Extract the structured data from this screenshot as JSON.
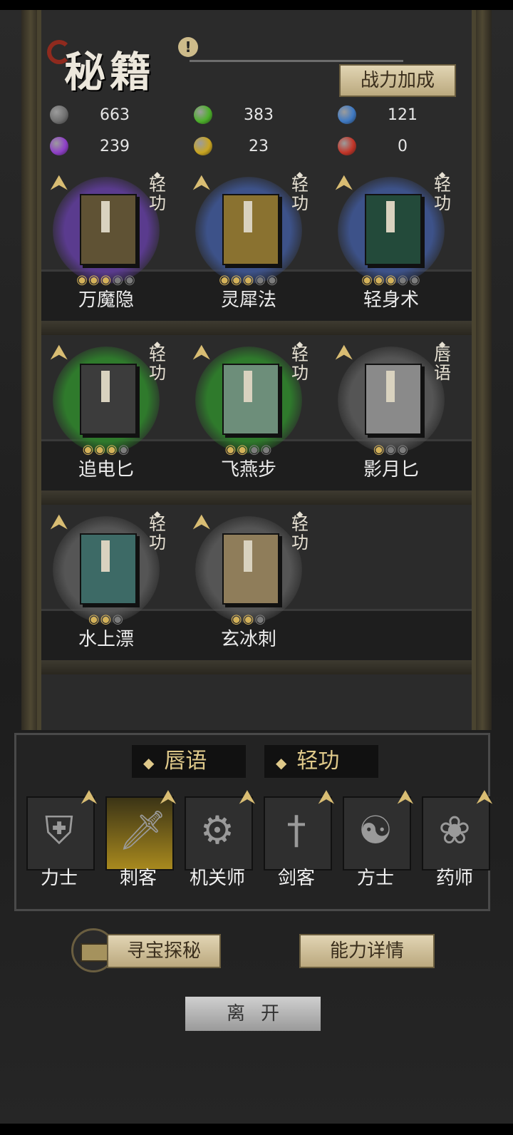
{
  "title": "秘籍",
  "bonus_button": "战力加成",
  "resources": [
    {
      "icon": "gray-gem-icon",
      "color": "#707070",
      "value": "663"
    },
    {
      "icon": "green-gem-icon",
      "color": "#4caf2a",
      "value": "383"
    },
    {
      "icon": "blue-gem-icon",
      "color": "#3f79c2",
      "value": "121"
    },
    {
      "icon": "purple-gem-icon",
      "color": "#8e3fc7",
      "value": "239"
    },
    {
      "icon": "gold-gem-icon",
      "color": "#c9a521",
      "value": "23"
    },
    {
      "icon": "red-gem-icon",
      "color": "#c23528",
      "value": "0"
    }
  ],
  "books": [
    {
      "name": "万魔隐",
      "type": "轻功",
      "aura": "#5a3b8e",
      "cover": "#5f5234",
      "stars_on": 3,
      "stars_total": 5
    },
    {
      "name": "灵犀法",
      "type": "轻功",
      "aura": "#3d5289",
      "cover": "#8a7230",
      "stars_on": 3,
      "stars_total": 5
    },
    {
      "name": "轻身术",
      "type": "轻功",
      "aura": "#3d5289",
      "cover": "#234a3a",
      "stars_on": 3,
      "stars_total": 5
    },
    {
      "name": "追电匕",
      "type": "轻功",
      "aura": "#2f7a2c",
      "cover": "#3c3c3c",
      "stars_on": 3,
      "stars_total": 4
    },
    {
      "name": "飞燕步",
      "type": "轻功",
      "aura": "#2f7a2c",
      "cover": "#6d8e7a",
      "stars_on": 2,
      "stars_total": 4
    },
    {
      "name": "影月匕",
      "type": "唇语",
      "aura": "#555555",
      "cover": "#8a8a8a",
      "stars_on": 1,
      "stars_total": 3
    },
    {
      "name": "水上漂",
      "type": "轻功",
      "aura": "#555555",
      "cover": "#3d6a66",
      "stars_on": 2,
      "stars_total": 3
    },
    {
      "name": "玄冰刺",
      "type": "轻功",
      "aura": "#555555",
      "cover": "#8f7d5a",
      "stars_on": 2,
      "stars_total": 3
    }
  ],
  "filters": [
    {
      "label": "唇语"
    },
    {
      "label": "轻功"
    }
  ],
  "classes": [
    {
      "name": "力士",
      "icon": "shield-icon",
      "glyph": "⛨",
      "active": false
    },
    {
      "name": "刺客",
      "icon": "dagger-icon",
      "glyph": "🗡",
      "active": true
    },
    {
      "name": "机关师",
      "icon": "gear-icon",
      "glyph": "⚙",
      "active": false
    },
    {
      "name": "剑客",
      "icon": "sword-icon",
      "glyph": "†",
      "active": false
    },
    {
      "name": "方士",
      "icon": "yin-yang-icon",
      "glyph": "☯",
      "active": false
    },
    {
      "name": "药师",
      "icon": "gourd-icon",
      "glyph": "❀",
      "active": false
    }
  ],
  "treasure_button": "寻宝探秘",
  "detail_button": "能力详情",
  "leave_button": "离开"
}
